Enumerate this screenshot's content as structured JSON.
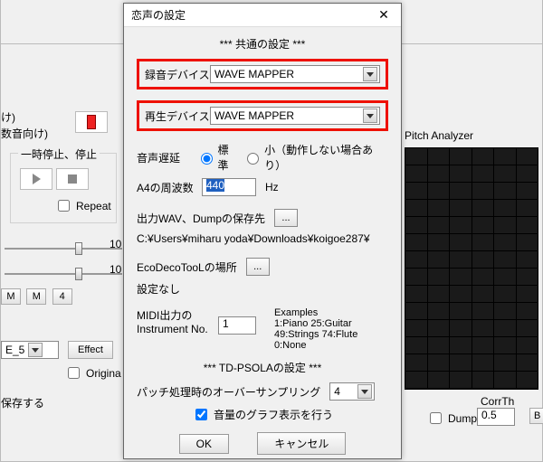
{
  "bg": {
    "left_label_1": "け)",
    "left_label_2": "数音向け)",
    "group_play": "一時停止、停止",
    "repeat": "Repeat",
    "slider_label": "10",
    "btn_m1": "M",
    "btn_m2": "M",
    "btn_4": "4",
    "preset_select": "E_5",
    "effect_btn": "Effect",
    "original_chk": "Origina",
    "save_label": "保存する",
    "pitch_header": "Pitch Analyzer",
    "dump_chk": "Dump",
    "corrth_label": "CorrTh",
    "corrth_value": "0.5",
    "btn_b": "B"
  },
  "dlg": {
    "title": "恋声の設定",
    "section_common": "*** 共通の設定 ***",
    "rec_label": "録音デバイス",
    "rec_value": "WAVE MAPPER",
    "play_label": "再生デバイス",
    "play_value": "WAVE MAPPER",
    "delay_label": "音声遅延",
    "delay_std": "標準",
    "delay_small": "小（動作しない場合あり）",
    "a4_label": "A4の周波数",
    "a4_value": "440",
    "a4_unit": "Hz",
    "outpath_label": "出力WAV、Dumpの保存先",
    "outpath_value": "C:¥Users¥miharu yoda¥Downloads¥koigoe287¥",
    "eco_label": "EcoDecoTooLの場所",
    "eco_value": "設定なし",
    "midi_label1": "MIDI出力の",
    "midi_label2": "Instrument No.",
    "midi_value": "1",
    "midi_examples_h": "Examples",
    "midi_examples_1": "1:Piano   25:Guitar",
    "midi_examples_2": "49:Strings  74:Flute",
    "midi_examples_3": "0:None",
    "section_tdpsola": "*** TD-PSOLAの設定 ***",
    "oversample_label": "パッチ処理時のオーバーサンプリング",
    "oversample_value": "4",
    "volgraph_label": "音量のグラフ表示を行う",
    "ok": "OK",
    "cancel": "キャンセル"
  }
}
